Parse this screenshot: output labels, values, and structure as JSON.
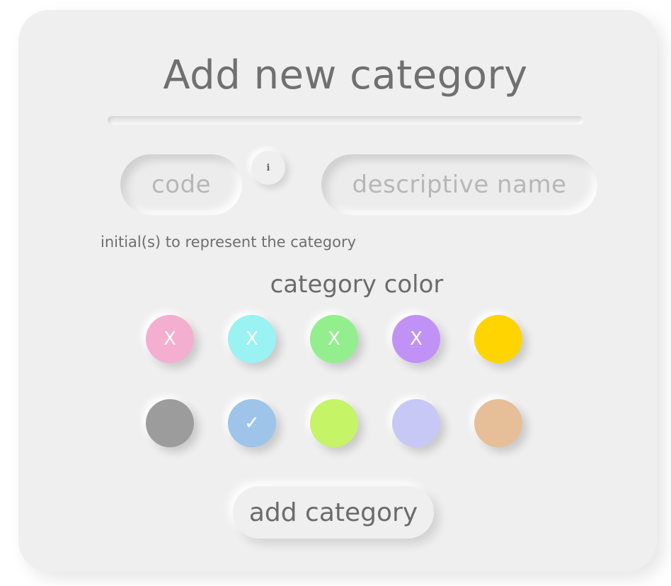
{
  "form": {
    "title": "Add new category",
    "code_placeholder": "code",
    "info_label": "i",
    "name_placeholder": "descriptive name",
    "code_hint": "initial(s) to represent the category",
    "color_section_title": "category color",
    "submit_label": "add category"
  },
  "colors": [
    {
      "name": "pink",
      "hex": "#f4aed0",
      "mark": "X",
      "state": "unavailable"
    },
    {
      "name": "cyan",
      "hex": "#9af2f2",
      "mark": "X",
      "state": "unavailable"
    },
    {
      "name": "green",
      "hex": "#93ee8e",
      "mark": "X",
      "state": "unavailable"
    },
    {
      "name": "purple",
      "hex": "#c192f6",
      "mark": "X",
      "state": "unavailable"
    },
    {
      "name": "yellow",
      "hex": "#ffd400",
      "mark": "",
      "state": "available"
    },
    {
      "name": "gray",
      "hex": "#9c9c9c",
      "mark": "",
      "state": "available"
    },
    {
      "name": "blue",
      "hex": "#9ec4ea",
      "mark": "✓",
      "state": "selected"
    },
    {
      "name": "lime",
      "hex": "#c5f467",
      "mark": "",
      "state": "available"
    },
    {
      "name": "lavender",
      "hex": "#c7c8f6",
      "mark": "",
      "state": "available"
    },
    {
      "name": "tan",
      "hex": "#e6bf98",
      "mark": "",
      "state": "available"
    }
  ]
}
